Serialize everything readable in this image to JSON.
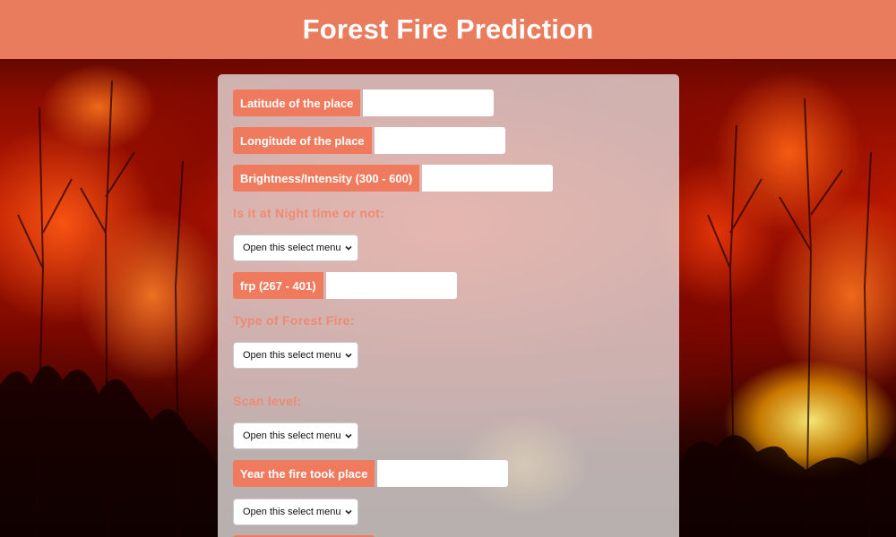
{
  "header": {
    "title": "Forest Fire Prediction"
  },
  "theme": {
    "header_bg": "#ea7c5e",
    "label_bg": "#f07a5d",
    "question_color": "#ee8a72",
    "card_bg": "#e8e2e0"
  },
  "form": {
    "latitude": {
      "label": "Latitude of the place",
      "value": ""
    },
    "longitude": {
      "label": "Longitude of the place",
      "value": ""
    },
    "brightness": {
      "label": "Brightness/Intensity (300 - 600)",
      "value": ""
    },
    "night": {
      "question": "Is it at Night time or not:",
      "selected": "Open this select menu"
    },
    "frp": {
      "label": "frp (267 - 401)",
      "value": ""
    },
    "fire_type": {
      "question": "Type of Forest Fire:",
      "selected": "Open this select menu"
    },
    "scan": {
      "question": "Scan level:",
      "selected": "Open this select menu"
    },
    "year": {
      "label": "Year the fire took place",
      "value": ""
    },
    "extra_select": {
      "selected": "Open this select menu"
    }
  },
  "icons": {
    "select_chevron": "chevron-down-icon"
  }
}
